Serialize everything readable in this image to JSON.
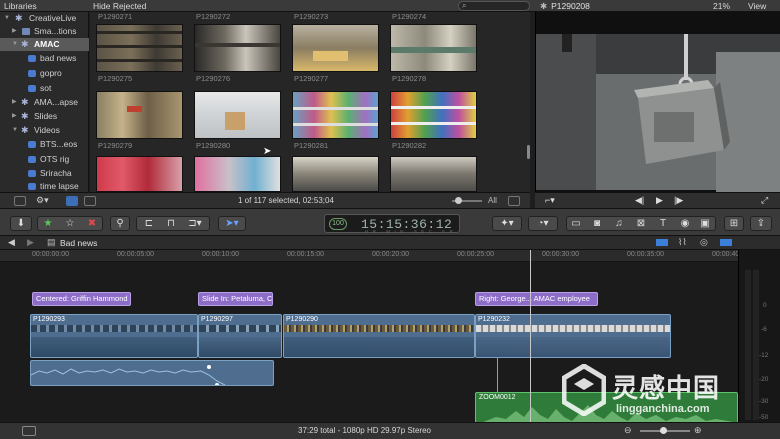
{
  "topbar": {
    "libraries_title": "Libraries",
    "browser_filter": "Hide Rejected",
    "viewer_clip": "P1290208",
    "zoom": "21%",
    "view_menu": "View"
  },
  "sidebar": {
    "items": [
      {
        "label": "CreativeLive",
        "kind": "library"
      },
      {
        "label": "Sma...tions",
        "kind": "event"
      },
      {
        "label": "AMAC",
        "kind": "event",
        "selected": true
      },
      {
        "label": "bad news",
        "kind": "keyword"
      },
      {
        "label": "gopro",
        "kind": "keyword"
      },
      {
        "label": "sot",
        "kind": "keyword"
      },
      {
        "label": "AMA...apse",
        "kind": "event"
      },
      {
        "label": "Slides",
        "kind": "event"
      },
      {
        "label": "Videos",
        "kind": "event"
      },
      {
        "label": "BTS...eos",
        "kind": "keyword"
      },
      {
        "label": "OTS rig",
        "kind": "keyword"
      },
      {
        "label": "Sriracha",
        "kind": "keyword"
      },
      {
        "label": "time lapse",
        "kind": "keyword"
      }
    ]
  },
  "browser": {
    "top_labels": [
      "P1290271",
      "P1290272",
      "P1290273",
      "P1290274"
    ],
    "clips": [
      {
        "label": "P1290275"
      },
      {
        "label": "P1290276"
      },
      {
        "label": "P1290277"
      },
      {
        "label": "P1290278"
      },
      {
        "label": "P1290279"
      },
      {
        "label": "P1290280"
      },
      {
        "label": "P1290281"
      },
      {
        "label": "P1290282"
      },
      {
        "label": ""
      },
      {
        "label": ""
      },
      {
        "label": ""
      },
      {
        "label": ""
      }
    ],
    "status": "1 of 117 selected, 02:53;04",
    "filter_all": "All"
  },
  "toolbar": {
    "timecode": "15:15:36:12",
    "timecode_percent": "100",
    "timecode_units": "HR MIN SEC FR"
  },
  "timeline": {
    "project_name": "Bad news",
    "ruler": [
      "00:00:00:00",
      "00:00:05:00",
      "00:00:10:00",
      "00:00:15:00",
      "00:00:20:00",
      "00:00:25:00",
      "00:00:30:00",
      "00:00:35:00",
      "00:00:40"
    ],
    "titles": [
      "Centered: Griffin Hammond",
      "Slide In: Petaluma, CA",
      "Right: George... AMAC employee"
    ],
    "video_clips": [
      "P1290293",
      "P1290297",
      "P1290290",
      "P1290232"
    ],
    "connected_clip": "ZOOM0012",
    "meter_scale": [
      "0",
      "-6",
      "-12",
      "-20",
      "-30",
      "-50"
    ]
  },
  "bottom": {
    "status": "37:29 total - 1080p HD 29.97p Stereo"
  },
  "watermark": {
    "title": "灵感中国",
    "url": "lingganchina.com"
  }
}
